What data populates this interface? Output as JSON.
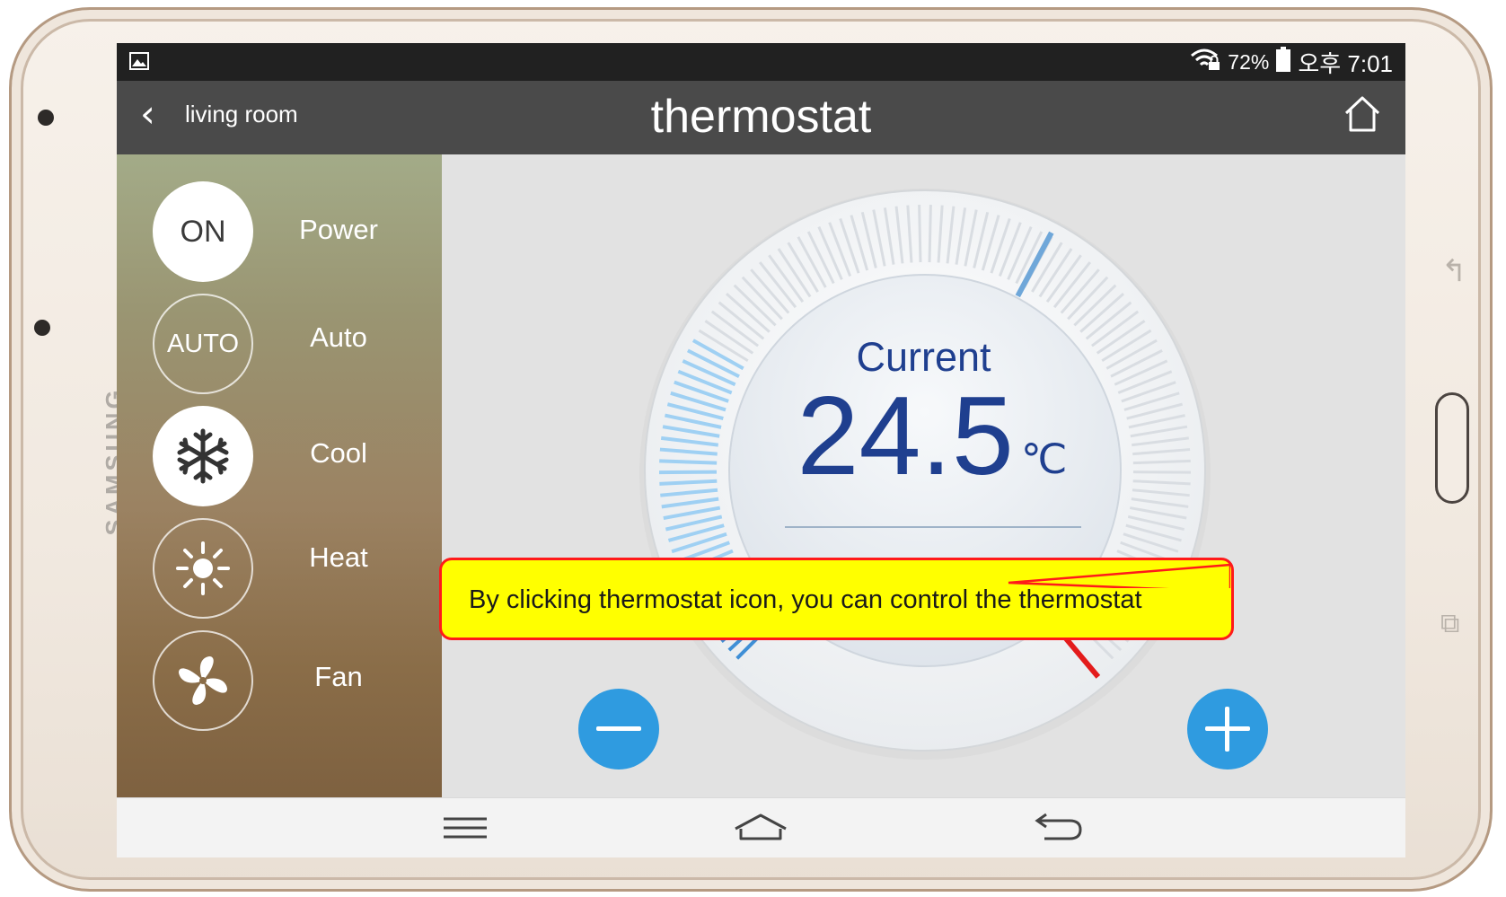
{
  "status": {
    "battery": "72%",
    "time": "오후 7:01"
  },
  "appbar": {
    "breadcrumb": "living room",
    "title": "thermostat"
  },
  "modes": [
    {
      "key": "power",
      "button": "ON",
      "label": "Power",
      "active": true
    },
    {
      "key": "auto",
      "button": "AUTO",
      "label": "Auto",
      "active": false
    },
    {
      "key": "cool",
      "icon": "snowflake-icon",
      "label": "Cool",
      "active": true
    },
    {
      "key": "heat",
      "icon": "sun-icon",
      "label": "Heat",
      "active": false
    },
    {
      "key": "fan",
      "icon": "fan-icon",
      "label": "Fan",
      "active": false
    }
  ],
  "dial": {
    "caption": "Current",
    "value": "24.5",
    "unit": "℃"
  },
  "device": {
    "brand": "SAMSUNG"
  },
  "callout": {
    "text": "By clicking thermostat icon, you can control the thermostat"
  },
  "colors": {
    "accent": "#2f9be0",
    "temp_text": "#1f3f8f",
    "callout_bg": "#ffff00",
    "callout_border": "#ff1a1a"
  }
}
